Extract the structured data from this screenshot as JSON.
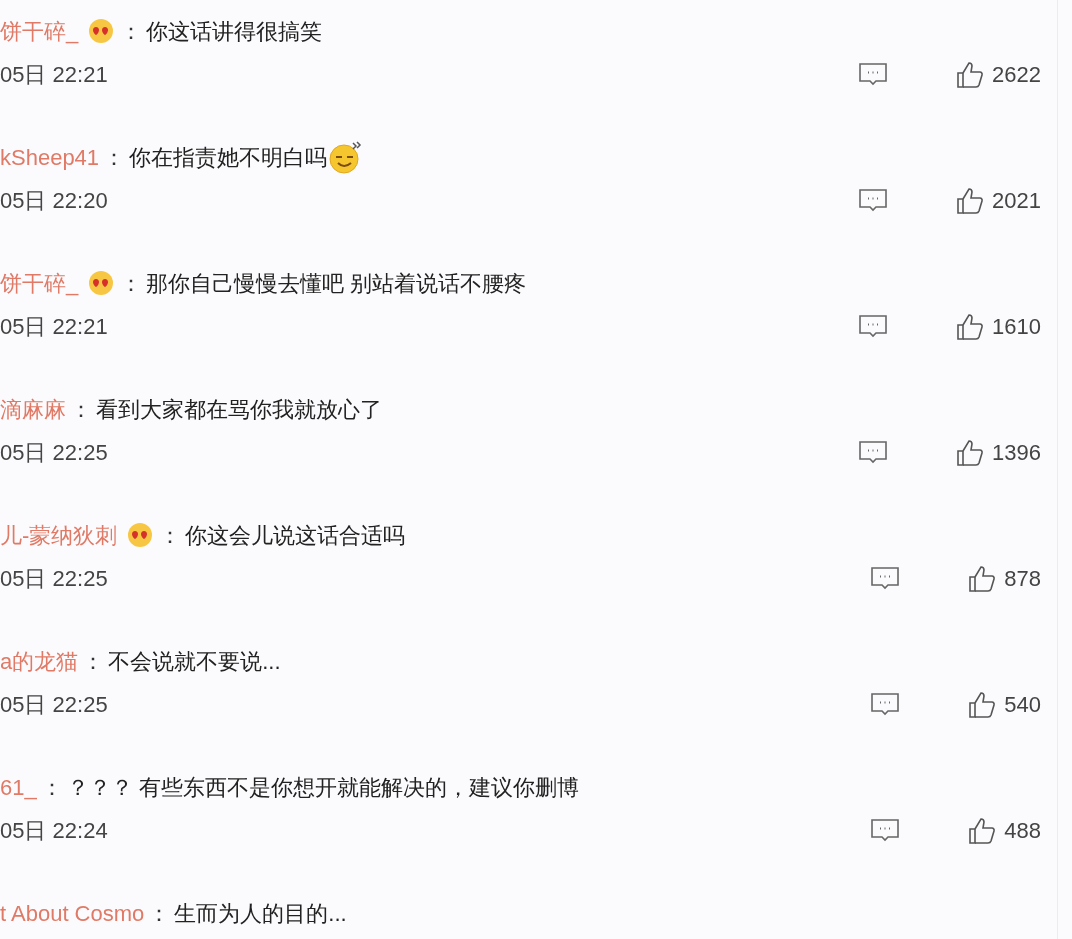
{
  "comments": [
    {
      "user": "饼干碎_",
      "badge": true,
      "separator": "：",
      "text": "你这话讲得很搞笑",
      "trailing_emoji": false,
      "time": "05日 22:21",
      "likes": "2622"
    },
    {
      "user": "kSheep41",
      "badge": false,
      "separator": "：",
      "text": "你在指责她不明白吗",
      "trailing_emoji": true,
      "time": "05日 22:20",
      "likes": "2021"
    },
    {
      "user": "饼干碎_",
      "badge": true,
      "separator": "：",
      "text": "那你自己慢慢去懂吧 别站着说话不腰疼",
      "trailing_emoji": false,
      "time": "05日 22:21",
      "likes": "1610"
    },
    {
      "user": "滴麻麻",
      "badge": false,
      "separator": "：",
      "text": "看到大家都在骂你我就放心了",
      "trailing_emoji": false,
      "time": "05日 22:25",
      "likes": "1396"
    },
    {
      "user": "儿-蒙纳狄刺",
      "badge": true,
      "separator": "：",
      "text": "你这会儿说这话合适吗",
      "trailing_emoji": false,
      "time": "05日 22:25",
      "likes": "878"
    },
    {
      "user": "a的龙猫",
      "badge": false,
      "separator": "：",
      "text": "不会说就不要说...",
      "trailing_emoji": false,
      "time": "05日 22:25",
      "likes": "540"
    },
    {
      "user": "61_",
      "badge": false,
      "separator": "：",
      "text": "？？？ 有些东西不是你想开就能解决的，建议你删博",
      "trailing_emoji": false,
      "time": "05日 22:24",
      "likes": "488"
    },
    {
      "user": "t About Cosmo",
      "badge": false,
      "separator": "：",
      "text": "生而为人的目的..."
    }
  ]
}
